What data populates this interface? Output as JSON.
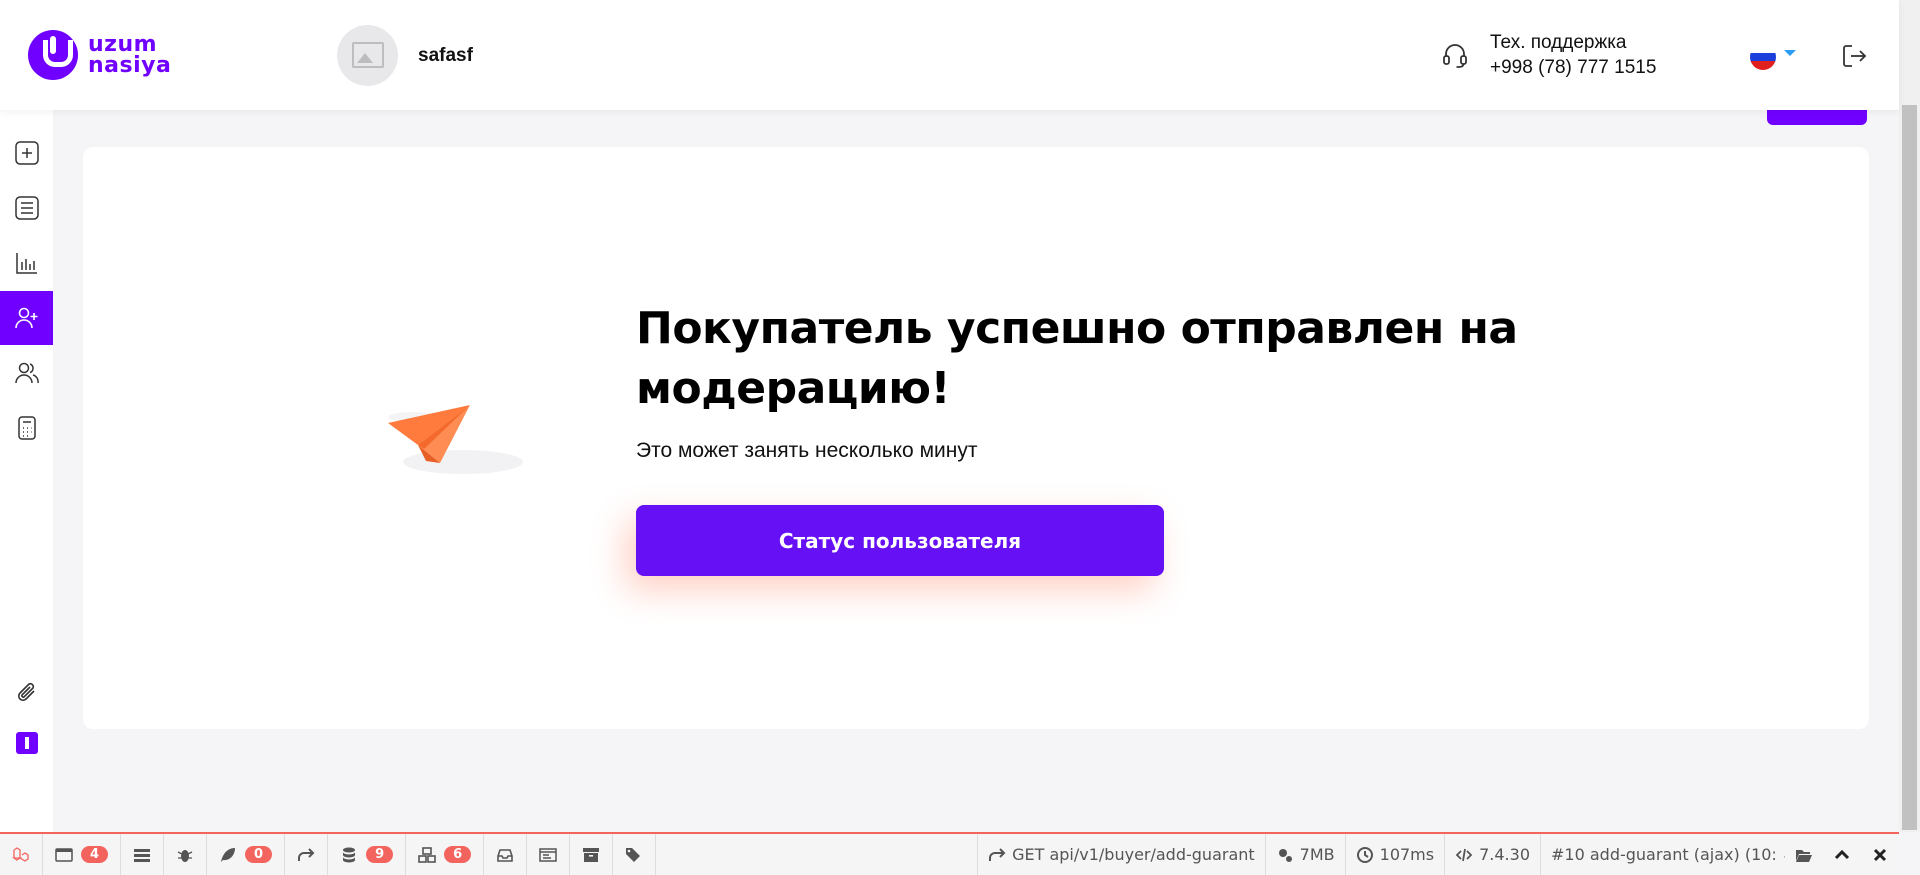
{
  "brand": {
    "line1": "uzum",
    "line2": "nasiya",
    "color": "#7000ff"
  },
  "user": {
    "name": "safasf"
  },
  "support": {
    "label": "Тех. поддержка",
    "phone": "+998 (78) 777 1515"
  },
  "language": {
    "current": "ru"
  },
  "sidebar": {
    "items": [
      {
        "icon": "plus-square-icon"
      },
      {
        "icon": "list-icon"
      },
      {
        "icon": "bar-chart-icon"
      },
      {
        "icon": "user-plus-icon",
        "active": true
      },
      {
        "icon": "users-icon"
      },
      {
        "icon": "calculator-icon"
      }
    ],
    "bottom": [
      {
        "icon": "paperclip-icon"
      },
      {
        "icon": "i-badge-icon"
      }
    ]
  },
  "main": {
    "title": "Покупатель успешно отправлен на модерацию!",
    "subtitle": "Это может занять несколько минут",
    "button_label": "Статус пользователя"
  },
  "debugbar": {
    "messages_count": "4",
    "views_count": "0",
    "queries_count": "9",
    "models_count": "6",
    "request": "GET api/v1/buyer/add-guarant",
    "memory": "7MB",
    "time": "107ms",
    "php_version": "7.4.30",
    "dataset": "#10 add-guarant (ajax) (10:",
    "accent": "#f4645f"
  }
}
